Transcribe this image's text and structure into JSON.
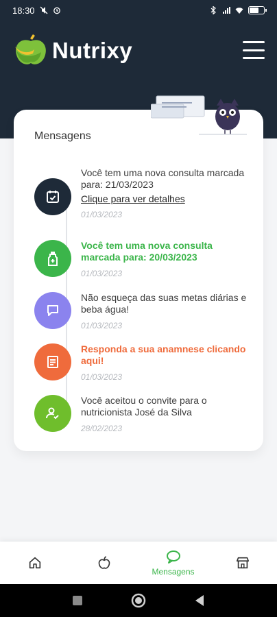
{
  "status_bar": {
    "time": "18:30"
  },
  "header": {
    "app_name": "Nutrixy"
  },
  "card": {
    "title": "Mensagens",
    "messages": [
      {
        "text": "Você tem uma nova consulta marcada para: 21/03/2023",
        "link": "Clique para ver detalhes",
        "date": "01/03/2023",
        "icon": "calendar-check-icon",
        "color": "#1e2a38"
      },
      {
        "text": "Você tem uma nova consulta marcada para: 20/03/2023",
        "date": "01/03/2023",
        "icon": "medicine-bottle-icon",
        "color": "#3bb54a"
      },
      {
        "text": "Não esqueça das suas metas diárias e beba água!",
        "date": "01/03/2023",
        "icon": "chat-bubble-icon",
        "color": "#8b83ee"
      },
      {
        "text": "Responda a sua anamnese clicando aqui!",
        "date": "01/03/2023",
        "icon": "document-icon",
        "color": "#ef6b3c"
      },
      {
        "text": "Você aceitou o convite para o nutricionista José da Silva",
        "date": "28/02/2023",
        "icon": "user-check-icon",
        "color": "#6fbe2c"
      }
    ]
  },
  "bottom_nav": {
    "items": [
      {
        "icon": "home-icon",
        "label": ""
      },
      {
        "icon": "apple-icon",
        "label": ""
      },
      {
        "icon": "chat-icon",
        "label": "Mensagens",
        "active": true
      },
      {
        "icon": "store-icon",
        "label": ""
      }
    ]
  }
}
